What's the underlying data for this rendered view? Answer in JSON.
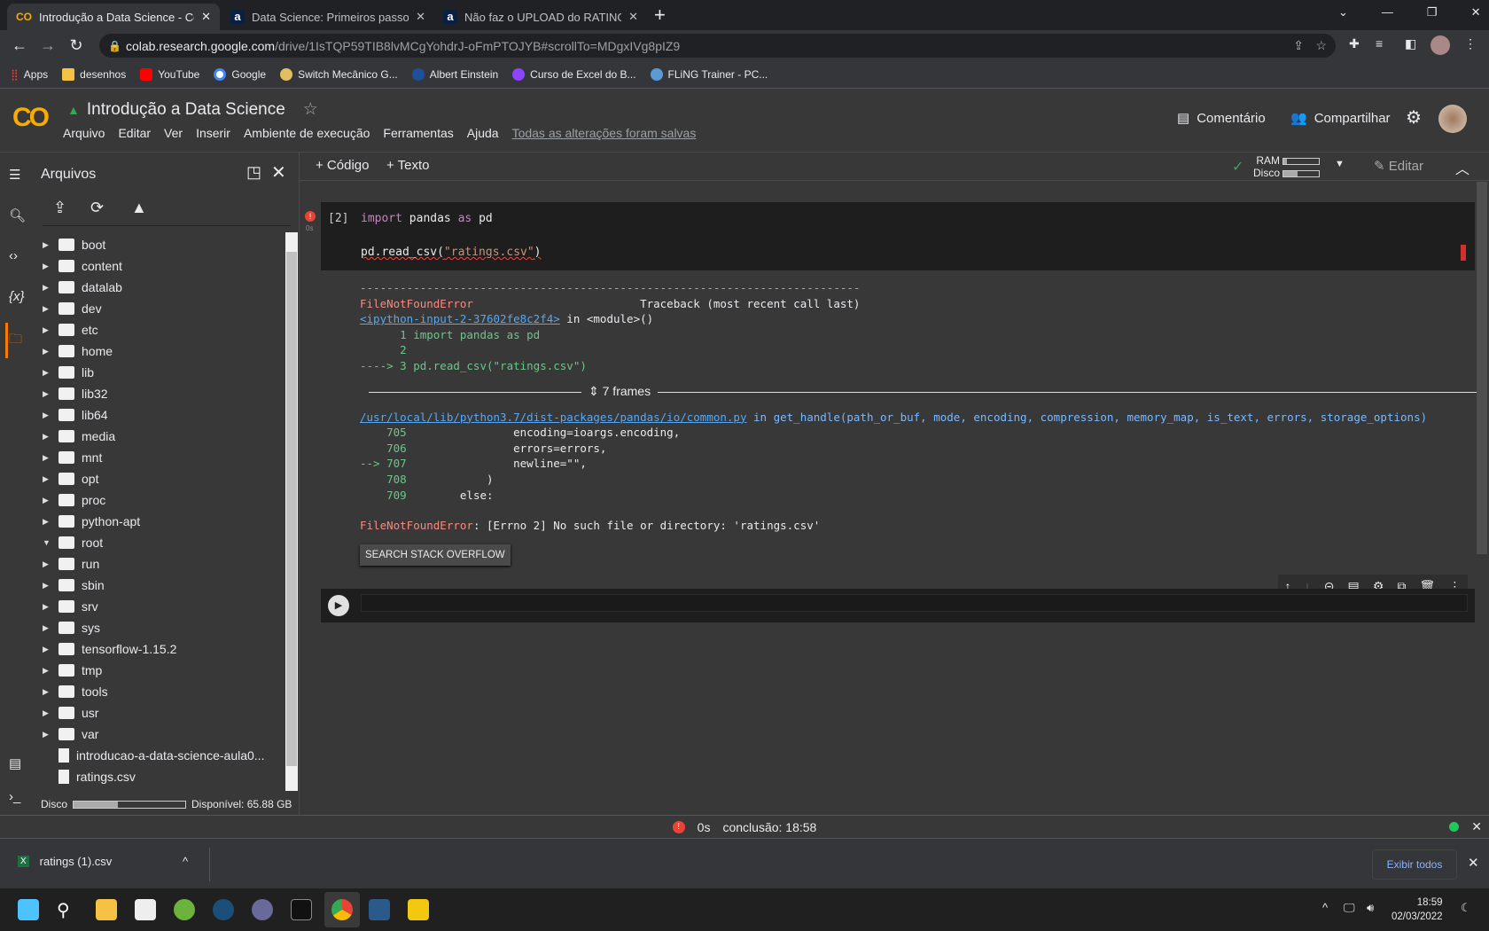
{
  "browser": {
    "tabs": [
      {
        "title": "Introdução a Data Science - Colab",
        "active": true
      },
      {
        "title": "Data Science: Primeiros passos: A"
      },
      {
        "title": "Não faz o UPLOAD do RATINGS.C"
      }
    ],
    "url_host": "colab.research.google.com",
    "url_path": "/drive/1IsTQP59TIB8lvMCgYohdrJ-oFmPTOJYB#scrollTo=MDgxIVg8pIZ9",
    "bookmarks": [
      {
        "label": "Apps",
        "color": "#ea4335"
      },
      {
        "label": "desenhos",
        "color": "#f6c244"
      },
      {
        "label": "YouTube",
        "color": "#ff0000"
      },
      {
        "label": "Google",
        "color": "#4285f4"
      },
      {
        "label": "Switch Mecânico G...",
        "color": "#e0c060"
      },
      {
        "label": "Albert Einstein",
        "color": "#1f4e9a"
      },
      {
        "label": "Curso de Excel do B...",
        "color": "#8e44ff"
      },
      {
        "label": "FLiNG Trainer - PC...",
        "color": "#5b9bd5"
      }
    ]
  },
  "colab": {
    "logo": "CO",
    "title": "Introdução a Data Science",
    "menu": [
      "Arquivo",
      "Editar",
      "Ver",
      "Inserir",
      "Ambiente de execução",
      "Ferramentas",
      "Ajuda"
    ],
    "saved_status": "Todas as alterações foram salvas",
    "comment": "Comentário",
    "share": "Compartilhar",
    "add_code": "+ Código",
    "add_text": "+ Texto",
    "ram_label": "RAM",
    "disk_label": "Disco",
    "ram_usage": 0.1,
    "disk_usage": 0.4,
    "edit": "Editar"
  },
  "sidebar": {
    "title": "Arquivos",
    "folders": [
      "boot",
      "content",
      "datalab",
      "dev",
      "etc",
      "home",
      "lib",
      "lib32",
      "lib64",
      "media",
      "mnt",
      "opt",
      "proc",
      "python-apt",
      "root",
      "run",
      "sbin",
      "srv",
      "sys",
      "tensorflow-1.15.2",
      "tmp",
      "tools",
      "usr",
      "var"
    ],
    "expanded": "root",
    "files": [
      "introducao-a-data-science-aula0...",
      "ratings.csv"
    ],
    "disk_label": "Disco",
    "disk_usage": 0.4,
    "available": "Disponível: 65.88 GB"
  },
  "cell": {
    "exec_count": "[2]",
    "time": "0s",
    "line1_kw": "import",
    "line1_a": " pandas ",
    "line1_kw2": "as",
    "line1_b": " pd",
    "line2_a": "pd.read_csv(",
    "line2_str": "\"ratings.csv\"",
    "line2_b": ")"
  },
  "output": {
    "dashes": "---------------------------------------------------------------------------",
    "err": "FileNotFoundError",
    "tb": "                         Traceback (most recent call last)",
    "input_link": "<ipython-input-2-37602fe8c2f4>",
    "in_module": " in <module>()",
    "l1": "      1 import pandas as pd",
    "l2": "      2",
    "l3": "----> 3 pd.read_csv(\"ratings.csv\")",
    "frames": "7 frames",
    "file_link": "/usr/local/lib/python3.7/dist-packages/pandas/io/common.py",
    "in_fn": " in get_handle(path_or_buf, mode, encoding, compression, memory_map, is_text, errors, storage_options)",
    "src": [
      [
        "    705",
        "                encoding=ioargs.encoding,"
      ],
      [
        "    706",
        "                errors=errors,"
      ],
      [
        "--> 707",
        "                newline=\"\","
      ],
      [
        "    708",
        "            )"
      ],
      [
        "    709",
        "        else:"
      ]
    ],
    "final_err": "FileNotFoundError",
    "final_msg": ": [Errno 2] No such file or directory: 'ratings.csv'",
    "so_button": "SEARCH STACK OVERFLOW"
  },
  "status": {
    "time": "0s",
    "completion": "conclusão: 18:58"
  },
  "download": {
    "file": "ratings (1).csv",
    "show_all": "Exibir todos"
  },
  "taskbar": {
    "time": "18:59",
    "date": "02/03/2022"
  }
}
